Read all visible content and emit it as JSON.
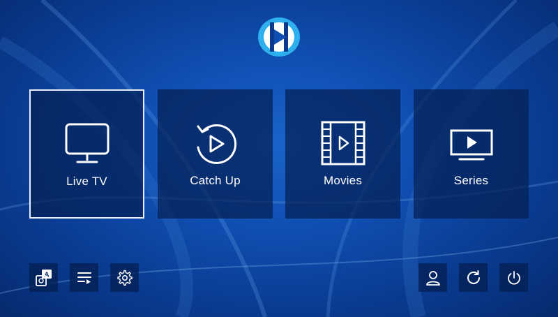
{
  "app": {
    "logo": "iptv-smarters-play-logo"
  },
  "tiles": [
    {
      "label": "Live TV",
      "icon": "tv-monitor-icon",
      "selected": true
    },
    {
      "label": "Catch Up",
      "icon": "replay-icon",
      "selected": false
    },
    {
      "label": "Movies",
      "icon": "film-strip-icon",
      "selected": false
    },
    {
      "label": "Series",
      "icon": "series-play-icon",
      "selected": false
    }
  ],
  "bottom_left": [
    {
      "icon": "language-translate-icon"
    },
    {
      "icon": "playlist-icon"
    },
    {
      "icon": "settings-gear-icon"
    }
  ],
  "bottom_right": [
    {
      "icon": "user-profile-icon"
    },
    {
      "icon": "refresh-icon"
    },
    {
      "icon": "power-icon"
    }
  ],
  "colors": {
    "background": "#0f4fb2",
    "tile": "#0a2a66",
    "accent": "#29a7e8",
    "text": "#ffffff"
  }
}
